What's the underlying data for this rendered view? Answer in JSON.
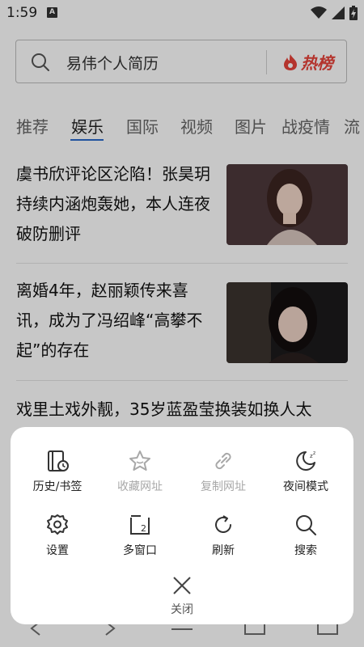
{
  "status_bar": {
    "time": "1:59",
    "notification_badge": "A"
  },
  "search": {
    "text": "易伟个人简历",
    "hot_label": "热榜"
  },
  "tabs": [
    {
      "label": "推荐"
    },
    {
      "label": "娱乐"
    },
    {
      "label": "国际"
    },
    {
      "label": "视频"
    },
    {
      "label": "图片"
    },
    {
      "label": "战疫情"
    },
    {
      "label": "流"
    }
  ],
  "articles": [
    {
      "title": "虞书欣评论区沦陷！张昊玥持续内涵炮轰她，本人连夜破防删评"
    },
    {
      "title": "离婚4年，赵丽颖传来喜讯，成为了冯绍峰“高攀不起”的存在"
    },
    {
      "title": "戏里土戏外靓，35岁蓝盈莹换装如换人太"
    }
  ],
  "menu": {
    "items": [
      {
        "label": "历史/书签",
        "icon": "history-bookmark-icon",
        "enabled": true
      },
      {
        "label": "收藏网址",
        "icon": "star-icon",
        "enabled": false
      },
      {
        "label": "复制网址",
        "icon": "link-icon",
        "enabled": false
      },
      {
        "label": "夜间模式",
        "icon": "moon-icon",
        "enabled": true
      },
      {
        "label": "设置",
        "icon": "gear-icon",
        "enabled": true
      },
      {
        "label": "多窗口",
        "icon": "windows-icon",
        "enabled": true,
        "count": "2"
      },
      {
        "label": "刷新",
        "icon": "refresh-icon",
        "enabled": true
      },
      {
        "label": "搜索",
        "icon": "search-icon",
        "enabled": true
      }
    ],
    "close_label": "关闭"
  },
  "colors": {
    "accent": "#2a6acb",
    "hot": "#e7433a",
    "disabled": "#a8a8a8"
  }
}
